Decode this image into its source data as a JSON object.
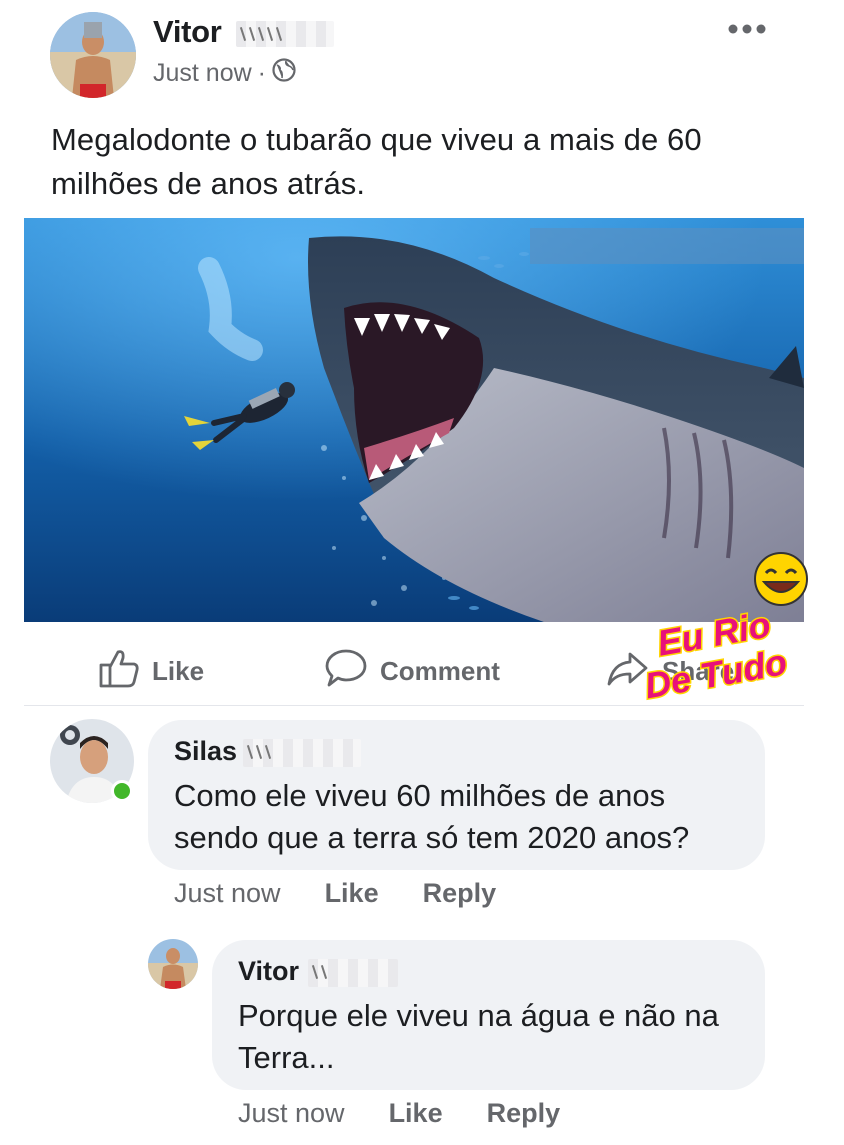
{
  "post": {
    "author": "Vitor",
    "time": "Just now",
    "separator": "·",
    "text": "Megalodonte o tubarão que viveu a mais de 60 milhões de anos atrás."
  },
  "actions": {
    "like": "Like",
    "comment": "Comment",
    "share": "Share"
  },
  "watermark": {
    "line1": "Eu Rio",
    "line2": "De Tudo"
  },
  "comments": [
    {
      "author": "Silas",
      "text": "Como ele viveu 60 milhões de anos sendo que a terra só tem 2020 anos?",
      "time": "Just now",
      "like": "Like",
      "reply": "Reply"
    },
    {
      "author": "Vitor",
      "text": "Porque ele viveu na água e não na Terra...",
      "time": "Just now",
      "like": "Like",
      "reply": "Reply"
    }
  ],
  "colors": {
    "secondary_text": "#65676b",
    "bubble": "#f0f2f5",
    "online": "#42b72a",
    "watermark_pink": "#e8117a",
    "watermark_yellow": "#ffd400"
  },
  "icons": [
    "globe-icon",
    "more-options-icon",
    "like-thumb-icon",
    "comment-bubble-icon",
    "share-arrow-icon",
    "laughing-emoji-icon"
  ]
}
